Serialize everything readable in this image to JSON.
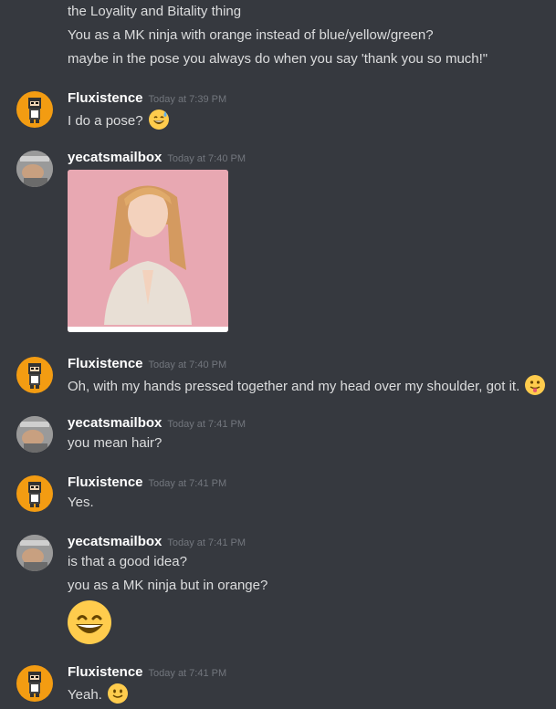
{
  "messages": {
    "m0": {
      "lines": [
        "the Loyality and Bitality thing",
        "You as a MK ninja with orange instead of blue/yellow/green?",
        "maybe in the pose you always do when you say 'thank you so much!\""
      ]
    },
    "m1": {
      "user": "Fluxistence",
      "time": "Today at 7:39 PM",
      "text": "I do a pose?",
      "emoji": "sweat-smile-emoji"
    },
    "m2": {
      "user": "yecatsmailbox",
      "time": "Today at 7:40 PM",
      "attachment": "photo-of-girl-with-pressed-hands"
    },
    "m3": {
      "user": "Fluxistence",
      "time": "Today at 7:40 PM",
      "text": "Oh, with my hands pressed together and my head over my shoulder, got it.",
      "emoji": "tongue-out-emoji"
    },
    "m4": {
      "user": "yecatsmailbox",
      "time": "Today at 7:41 PM",
      "text": "you mean hair?"
    },
    "m5": {
      "user": "Fluxistence",
      "time": "Today at 7:41 PM",
      "text": "Yes."
    },
    "m6": {
      "user": "yecatsmailbox",
      "time": "Today at 7:41 PM",
      "lines": [
        "is that a good idea?",
        "you as a MK ninja but in orange?"
      ],
      "emoji": "grinning-emoji"
    },
    "m7": {
      "user": "Fluxistence",
      "time": "Today at 7:41 PM",
      "text": "Yeah.",
      "emoji": "slight-smile-emoji"
    }
  },
  "colors": {
    "background": "#36393f",
    "username": "#ffffff",
    "text": "#dcddde",
    "timestamp": "#72767d",
    "avatar_orange": "#f39c12",
    "emoji_yellow": "#ffcc4d"
  }
}
